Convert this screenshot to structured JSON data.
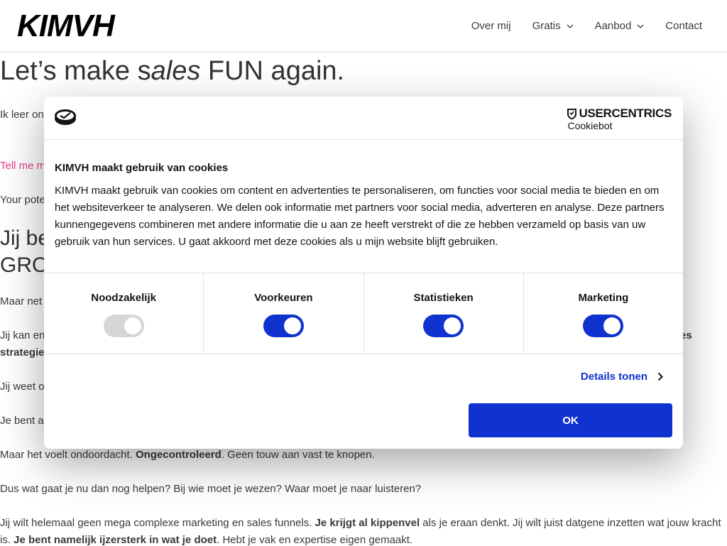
{
  "header": {
    "logo": "KIMVH",
    "nav": [
      {
        "label": "Over mij",
        "dropdown": false
      },
      {
        "label": "Gratis",
        "dropdown": true
      },
      {
        "label": "Aanbod",
        "dropdown": true
      },
      {
        "label": "Contact",
        "dropdown": false
      }
    ]
  },
  "page": {
    "hero_pre": "Let’s make s",
    "hero_em": "ales",
    "hero_post": " FUN again.",
    "intro_fragment": "Ik leer on",
    "link_fragment": "Tell me m",
    "potential_fragment": "Your pote",
    "h2_line1": "Jij be",
    "h2_line2": "GRO",
    "p_maar_net": "Maar net",
    "p_jij_kan": "Jij kan en",
    "p_jij_kan_right": "es",
    "p_strategie": "strategie",
    "p_jij_weet": "Jij weet o",
    "p_je_bent": "Je bent a",
    "p_ondoordacht_1": "Maar het voelt ondoordacht. ",
    "p_ondoordacht_bold": "Ongecontroleerd",
    "p_ondoordacht_2": ". Geen touw aan vast te knopen.",
    "p_dus": "Dus wat gaat je nu dan nog helpen? Bij wie moet je wezen? Waar moet je naar luisteren?",
    "p_complex_1": "Jij wilt helemaal geen mega complexe marketing en sales funnels. ",
    "p_complex_bold": "Je krijgt al kippenvel",
    "p_complex_2": " als je eraan denkt. Jij wilt juist datgene inzetten wat jouw kracht",
    "p_last_1": "is. ",
    "p_last_bold": "Je bent namelijk ijzersterk in wat je doet",
    "p_last_2": ". Hebt je vak en expertise eigen gemaakt."
  },
  "cookie": {
    "brand": "USERCENTRICS",
    "brand_sub": "Cookiebot",
    "title": "KIMVH maakt gebruik van cookies",
    "text": "KIMVH maakt gebruik van cookies om content en advertenties te personaliseren, om functies voor social media te bieden en om het websiteverkeer te analyseren. We delen ook informatie met partners voor social media, adverteren en analyse. Deze partners kunnengegevens combineren met andere informatie die u aan ze heeft verstrekt of die ze hebben verzameld op basis van uw gebruik van hun services. U gaat akkoord met deze cookies als u mijn website blijft gebruiken.",
    "toggles": [
      {
        "label": "Noodzakelijk",
        "on": true,
        "disabled": true
      },
      {
        "label": "Voorkeuren",
        "on": true,
        "disabled": false
      },
      {
        "label": "Statistieken",
        "on": true,
        "disabled": false
      },
      {
        "label": "Marketing",
        "on": true,
        "disabled": false
      }
    ],
    "details_label": "Details tonen",
    "ok_label": "OK",
    "accent_color": "#1032cf"
  }
}
